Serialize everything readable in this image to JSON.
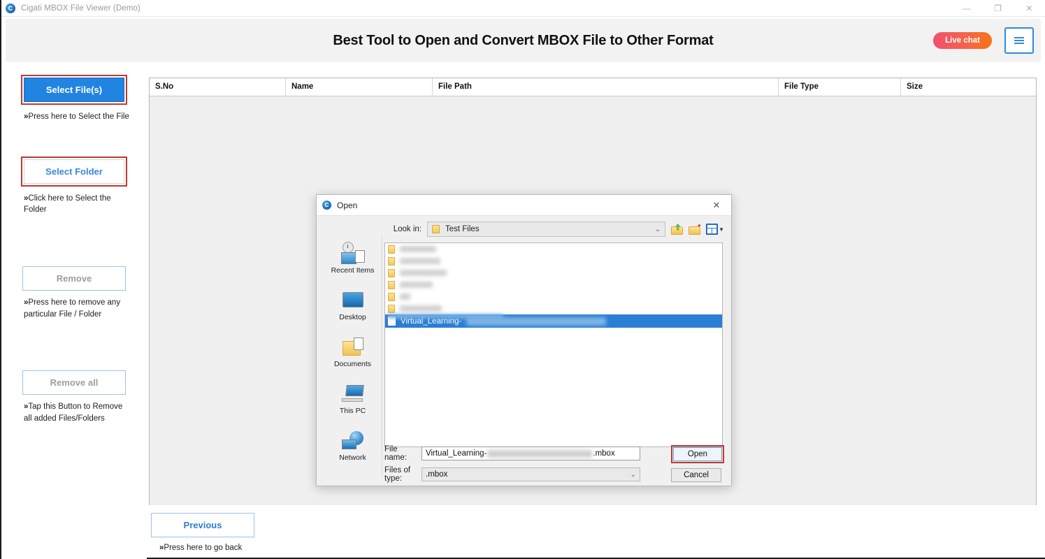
{
  "window": {
    "title": "Cigati MBOX File Viewer (Demo)",
    "logo_glyph": "C",
    "minimize": "—",
    "maximize": "❐",
    "close": "✕"
  },
  "header": {
    "title": "Best Tool to Open and Convert MBOX File to Other Format",
    "live_chat": "Live chat",
    "accent_blue": "#2184e0",
    "chat_gradient_from": "#f2506e",
    "chat_gradient_to": "#f97316",
    "highlight_red": "#c0392b"
  },
  "sidebar": {
    "select_files_label": "Select File(s)",
    "select_files_hint_prefix": "»",
    "select_files_hint": "Press here to Select the File",
    "select_folder_label": "Select Folder",
    "select_folder_hint_prefix": "»",
    "select_folder_hint": "Click here to Select the Folder",
    "remove_label": "Remove",
    "remove_hint_prefix": "»",
    "remove_hint": "Press here to remove any particular File / Folder",
    "remove_all_label": "Remove all",
    "remove_all_hint_prefix": "»",
    "remove_all_hint": "Tap this Button to Remove all added Files/Folders"
  },
  "table": {
    "columns": [
      "S.No",
      "Name",
      "File Path",
      "File Type",
      "Size"
    ],
    "rows": []
  },
  "footer": {
    "previous_label": "Previous",
    "previous_hint_prefix": "»",
    "previous_hint": "Press here to go back"
  },
  "dialog": {
    "title": "Open",
    "logo_glyph": "C",
    "close_glyph": "✕",
    "look_in_label": "Look in:",
    "look_in_value": "Test Files",
    "chevron": "⌄",
    "toolbar": {
      "up_one_level": "up-one-level",
      "new_folder": "create-new-folder",
      "view_menu": "view-menu"
    },
    "places": [
      {
        "label": "Recent Items",
        "icon": "recent-items-icon"
      },
      {
        "label": "Desktop",
        "icon": "desktop-icon"
      },
      {
        "label": "Documents",
        "icon": "documents-icon"
      },
      {
        "label": "This PC",
        "icon": "this-pc-icon"
      },
      {
        "label": "Network",
        "icon": "network-icon"
      }
    ],
    "file_list": [
      {
        "type": "folder",
        "name": "",
        "redacted": true,
        "width": 52
      },
      {
        "type": "folder",
        "name": "",
        "redacted": true,
        "width": 58
      },
      {
        "type": "folder",
        "name": "",
        "redacted": true,
        "width": 67
      },
      {
        "type": "folder",
        "name": "",
        "redacted": true,
        "width": 47
      },
      {
        "type": "folder",
        "name": "",
        "redacted": true,
        "width": 15
      },
      {
        "type": "folder",
        "name": "",
        "redacted": true,
        "width": 60
      }
    ],
    "selected_file": {
      "type": "file",
      "name": "Virtual_Learning-",
      "redacted_tail": true
    },
    "file_name_label": "File name:",
    "file_name_prefix": "Virtual_Learning-",
    "file_name_suffix": ".mbox",
    "files_of_type_label": "Files of type:",
    "files_of_type_value": ".mbox",
    "files_of_type_options": [
      ".mbox"
    ],
    "open_label": "Open",
    "cancel_label": "Cancel"
  }
}
